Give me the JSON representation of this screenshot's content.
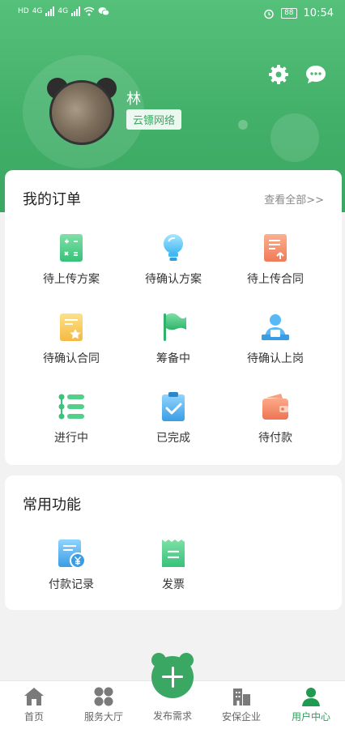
{
  "status_bar": {
    "left_text_1": "HD",
    "left_text_2": "HD",
    "network_1": "4G",
    "network_2": "4G",
    "battery": "88",
    "time": "10:54"
  },
  "profile": {
    "username": "林",
    "company": "云镖网络"
  },
  "orders": {
    "title": "我的订单",
    "view_all": "查看全部>>",
    "items": [
      {
        "label": "待上传方案",
        "icon": "calculator-doc-icon"
      },
      {
        "label": "待确认方案",
        "icon": "lightbulb-icon"
      },
      {
        "label": "待上传合同",
        "icon": "upload-contract-icon"
      },
      {
        "label": "待确认合同",
        "icon": "star-doc-icon"
      },
      {
        "label": "筹备中",
        "icon": "flag-icon"
      },
      {
        "label": "待确认上岗",
        "icon": "worker-desk-icon"
      },
      {
        "label": "进行中",
        "icon": "list-icon"
      },
      {
        "label": "已完成",
        "icon": "clipboard-check-icon"
      },
      {
        "label": "待付款",
        "icon": "wallet-icon"
      }
    ]
  },
  "functions": {
    "title": "常用功能",
    "items": [
      {
        "label": "付款记录",
        "icon": "payment-record-icon"
      },
      {
        "label": "发票",
        "icon": "invoice-icon"
      }
    ]
  },
  "tabbar": {
    "items": [
      {
        "label": "首页",
        "icon": "home-icon"
      },
      {
        "label": "服务大厅",
        "icon": "service-hall-icon"
      },
      {
        "label": "发布需求",
        "icon": "publish-plus-icon"
      },
      {
        "label": "安保企业",
        "icon": "building-icon"
      },
      {
        "label": "用户中心",
        "icon": "user-icon"
      }
    ],
    "active": "用户中心"
  },
  "colors": {
    "brand_green": "#3aa862",
    "active_tab": "#2ea05a"
  }
}
